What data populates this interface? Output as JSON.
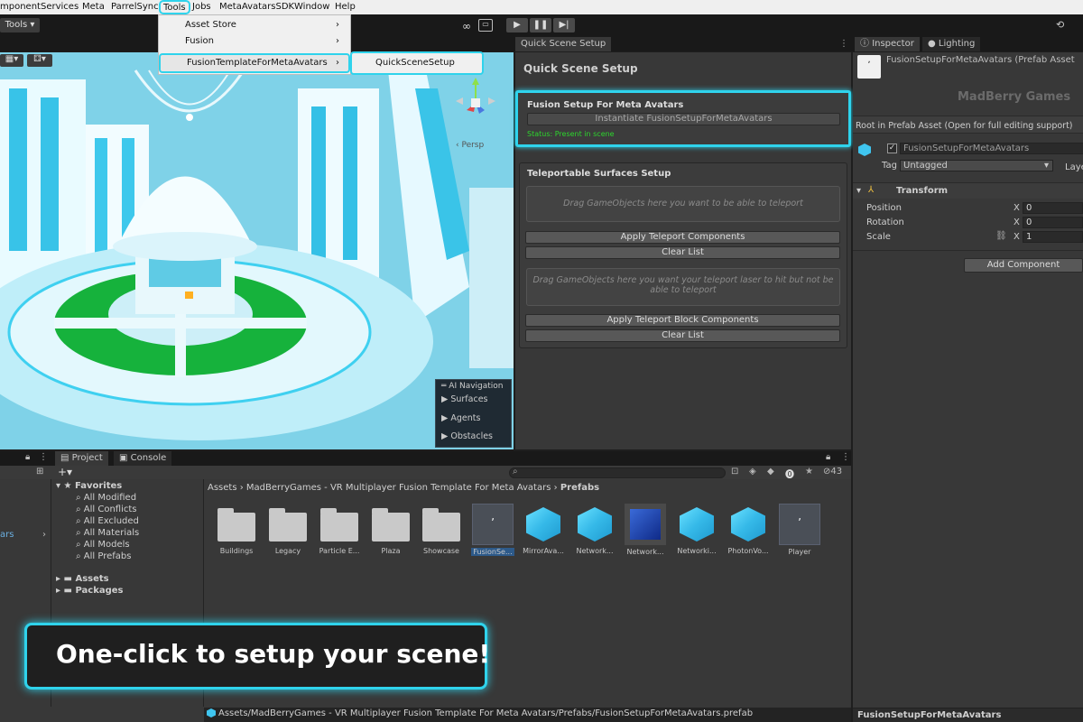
{
  "menubar": {
    "items": [
      "mponent",
      "Services",
      "Meta",
      "ParrelSync",
      "Tools",
      "Jobs",
      "MetaAvatarsSDK",
      "Window",
      "Help"
    ]
  },
  "toolbar": {
    "tools_label": "Tools",
    "tools_arrow": "▾"
  },
  "tools_menu": {
    "items": [
      {
        "label": "Asset Store",
        "arrow": "›"
      },
      {
        "label": "Fusion",
        "arrow": "›"
      },
      {
        "label": "FusionTemplateForMetaAvatars",
        "arrow": "›"
      }
    ],
    "submenu_item": "QuickSceneSetup"
  },
  "scene_view": {
    "persp_label": "‹ Persp",
    "ai_nav": {
      "title": "AI Navigation",
      "items": [
        "Surfaces",
        "Agents",
        "Obstacles"
      ]
    }
  },
  "quick_setup": {
    "tab_label": "Quick Scene Setup",
    "header": "Quick Scene Setup",
    "fusion_title": "Fusion Setup For Meta Avatars",
    "instantiate_button": "Instantiate FusionSetupForMetaAvatars",
    "status_text": "Status: Present in scene",
    "teleport_title": "Teleportable Surfaces Setup",
    "drop1": "Drag GameObjects here you want to be able to teleport",
    "apply_teleport": "Apply Teleport Components",
    "clear1": "Clear List",
    "drop2": "Drag GameObjects here you want your teleport laser to hit but not be able to teleport",
    "apply_block": "Apply Teleport Block Components",
    "clear2": "Clear List",
    "accent": "#2fd3ec",
    "status_color": "#2dd62d"
  },
  "inspector": {
    "tab_inspector": "Inspector",
    "tab_lighting": "Lighting",
    "asset_title": "FusionSetupForMetaAvatars (Prefab Asset",
    "watermark": "MadBerry Games",
    "root_text": "Root in Prefab Asset (Open for full editing support)",
    "object_name": "FusionSetupForMetaAvatars",
    "tag_label": "Tag",
    "tag_value": "Untagged",
    "layer_label": "Laye",
    "transform_label": "Transform",
    "position_label": "Position",
    "rotation_label": "Rotation",
    "scale_label": "Scale",
    "axis_x": "X",
    "position_x": "0",
    "rotation_x": "0",
    "scale_x": "1",
    "add_component": "Add Component",
    "footer_name": "FusionSetupForMetaAvatars"
  },
  "project": {
    "tab_project": "Project",
    "tab_console": "Console",
    "hidden_count": "43",
    "breadcrumb": {
      "part1": "Assets",
      "part2": "MadBerryGames - VR Multiplayer Fusion Template For Meta Avatars",
      "part3": "Prefabs"
    },
    "favorites_label": "Favorites",
    "favorites": [
      "All Modified",
      "All Conflicts",
      "All Excluded",
      "All Materials",
      "All Models",
      "All Prefabs"
    ],
    "assets_label": "Assets",
    "packages_label": "Packages",
    "left_partial": "ars",
    "asset_items": [
      {
        "label": "Buildings",
        "kind": "folder"
      },
      {
        "label": "Legacy",
        "kind": "folder"
      },
      {
        "label": "Particle E...",
        "kind": "folder"
      },
      {
        "label": "Plaza",
        "kind": "folder"
      },
      {
        "label": "Showcase",
        "kind": "folder"
      },
      {
        "label": "FusionSe...",
        "kind": "prefab-selected"
      },
      {
        "label": "MirrorAva...",
        "kind": "cube"
      },
      {
        "label": "Network...",
        "kind": "cube"
      },
      {
        "label": "Network...",
        "kind": "dark-cube"
      },
      {
        "label": "Networki...",
        "kind": "cube"
      },
      {
        "label": "PhotonVo...",
        "kind": "cube"
      },
      {
        "label": "Player",
        "kind": "prefab"
      }
    ]
  },
  "status_path": "Assets/MadBerryGames - VR Multiplayer Fusion Template For Meta Avatars/Prefabs/FusionSetupForMetaAvatars.prefab",
  "callout_text": "One-click to setup your scene!"
}
